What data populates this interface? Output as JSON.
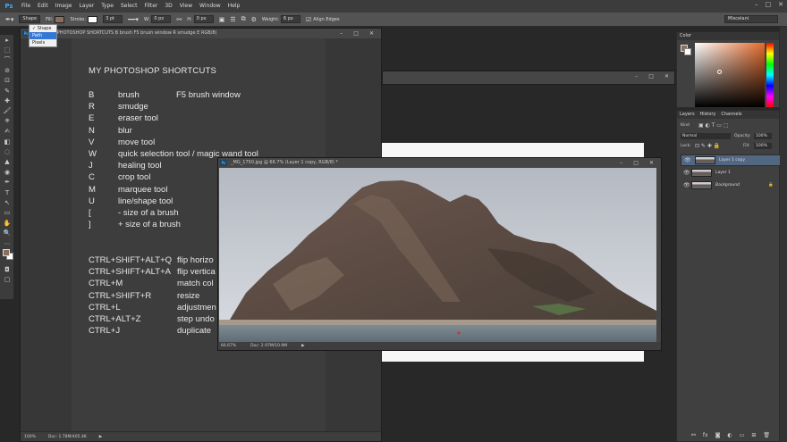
{
  "app": {
    "logo": "Ps"
  },
  "menu": [
    "File",
    "Edit",
    "Image",
    "Layer",
    "Type",
    "Select",
    "Filter",
    "3D",
    "View",
    "Window",
    "Help"
  ],
  "window_controls": [
    "–",
    "□",
    "✕"
  ],
  "options": {
    "mode": "Shape",
    "fill_label": "Fill:",
    "stroke_label": "Stroke:",
    "stroke_width": "3 pt",
    "w_label": "W:",
    "w_value": "0 px",
    "h_label": "H:",
    "h_value": "0 px",
    "weight_label": "Weight:",
    "weight_value": "6 px",
    "align_label": "Align Edges",
    "workspace": "Miscelani",
    "fill_color": "#8b6f5d"
  },
  "dropdown": [
    "✓ Shape",
    "Path",
    "Pixels"
  ],
  "toolbox_icons": [
    "▸",
    "⬚",
    "⌒",
    "⊘",
    "⊡",
    "✎",
    "✚",
    "🖌",
    "⎈",
    "✍",
    "◧",
    "◌",
    "▲",
    "◉",
    "✒",
    "T",
    "↖",
    "▭",
    "✋",
    "🔍",
    "⋯"
  ],
  "doc1": {
    "title": "100% (MY PHOTOSHOP SHORTCUTS  B  brush  F5  brush window  R  smudge  E  RGB/8)",
    "status_zoom": "100%",
    "status_doc": "Doc: 1.78M/405.4K",
    "heading": "MY PHOTOSHOP SHORTCUTS",
    "shortcuts": [
      {
        "key": "B",
        "desc": "brush",
        "extra": "F5  brush window"
      },
      {
        "key": "R",
        "desc": "smudge",
        "extra": ""
      },
      {
        "key": "E",
        "desc": "eraser tool",
        "extra": ""
      },
      {
        "key": "N",
        "desc": "blur",
        "extra": ""
      },
      {
        "key": "V",
        "desc": "move tool",
        "extra": ""
      },
      {
        "key": "W",
        "desc": "quick selection tool / magic wand tool",
        "extra": ""
      },
      {
        "key": "J",
        "desc": "healing tool",
        "extra": ""
      },
      {
        "key": "C",
        "desc": "crop tool",
        "extra": ""
      },
      {
        "key": "M",
        "desc": "marquee tool",
        "extra": ""
      },
      {
        "key": "U",
        "desc": "line/shape tool",
        "extra": ""
      },
      {
        "key": "[",
        "desc": "- size of a brush",
        "extra": ""
      },
      {
        "key": "]",
        "desc": "+ size of a brush",
        "extra": ""
      }
    ],
    "combos": [
      {
        "key": "CTRL+SHIFT+ALT+Q",
        "desc": "flip horizo"
      },
      {
        "key": "CTRL+SHIFT+ALT+A",
        "desc": "flip vertica"
      },
      {
        "key": "CTRL+M",
        "desc": "match col"
      },
      {
        "key": "CTRL+SHIFT+R",
        "desc": "resize"
      },
      {
        "key": "CTRL+L",
        "desc": "adjustmen"
      },
      {
        "key": "CTRL+ALT+Z",
        "desc": "step undo"
      },
      {
        "key": "CTRL+J",
        "desc": "duplicate"
      }
    ]
  },
  "doc2": {
    "title": "_MG_1750.jpg @ 66.7% (Layer 1 copy, RGB/8) *",
    "status_zoom": "66.67%",
    "status_doc": "Doc: 2.97M/10.9M"
  },
  "panels": {
    "color_tab": "Color",
    "layer_tabs": [
      "Layers",
      "History",
      "Channels"
    ],
    "kind_label": "Kind",
    "blend_mode": "Normal",
    "opacity_label": "Opacity:",
    "opacity_value": "100%",
    "lock_label": "Lock:",
    "fill_label": "Fill:",
    "fill_value": "100%",
    "layers": [
      "Layer 1 copy",
      "Layer 1",
      "Background"
    ],
    "fg_color": "#8b6f5d"
  }
}
